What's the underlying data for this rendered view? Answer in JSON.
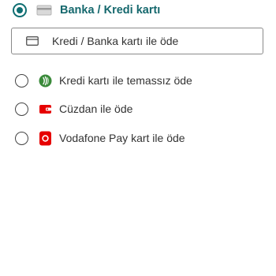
{
  "payment": {
    "section_title": "Banka / Kredi kartı",
    "card_option_label": "Kredi / Banka kartı ile öde",
    "options": [
      {
        "label": "Kredi kartı ile temassız öde",
        "icon": "contactless-icon",
        "color": "#3a8a3a"
      },
      {
        "label": "Cüzdan ile öde",
        "icon": "wallet-icon",
        "color": "#e60000"
      },
      {
        "label": "Vodafone Pay kart ile öde",
        "icon": "vodafone-pay-icon",
        "color": "#e60000"
      }
    ]
  },
  "colors": {
    "accent": "#0e6e72",
    "brand_red": "#e60000",
    "green": "#3a8a3a"
  }
}
